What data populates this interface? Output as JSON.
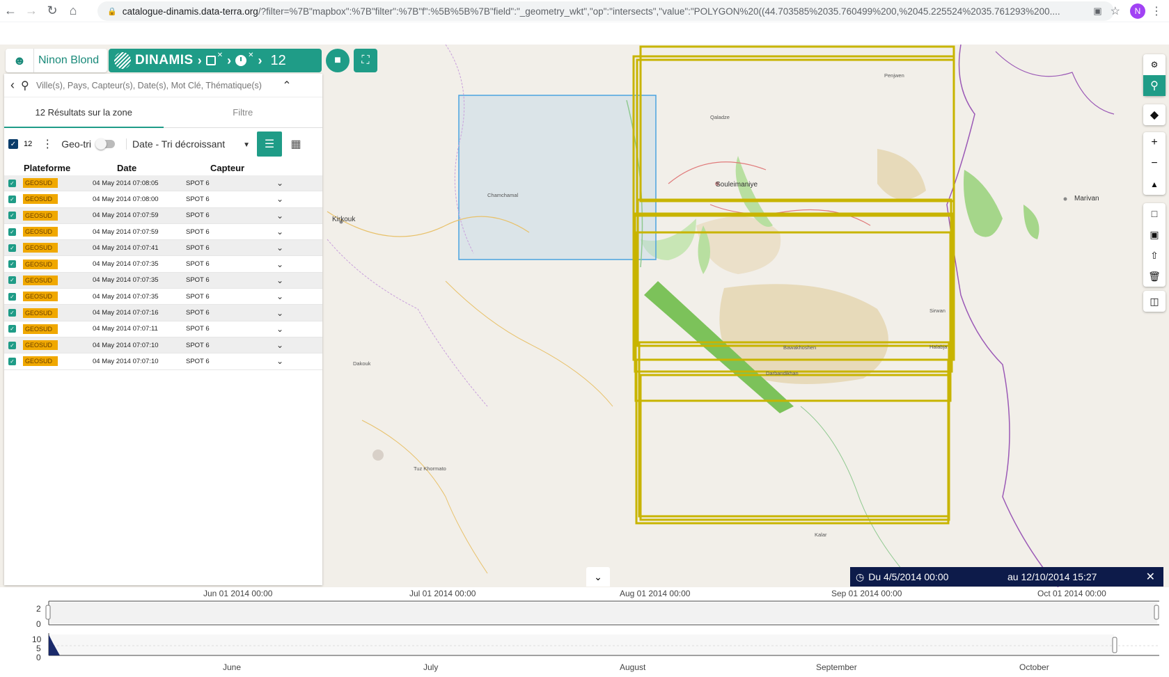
{
  "browser": {
    "url_host": "catalogue-dinamis.data-terra.org",
    "url_rest": "/?filter=%7B\"mapbox\":%7B\"filter\":%7B\"f\":%5B%5B%7B\"field\":\"_geometry_wkt\",\"op\":\"intersects\",\"value\":\"POLYGON%20((44.703585%2035.760499%200,%2045.225524%2035.761293%200....",
    "profile_initial": "N"
  },
  "header": {
    "user_name": "Ninon Blond",
    "brand": "DINAMIS",
    "result_count": "12"
  },
  "search": {
    "placeholder": "Ville(s), Pays, Capteur(s), Date(s), Mot Clé, Thématique(s)"
  },
  "tabs": [
    {
      "label": "12 Résultats sur la zone"
    },
    {
      "label": "Filtre"
    }
  ],
  "toolbar": {
    "selected_count": "12",
    "geotri_label": "Geo-tri",
    "sort_label": "Date - Tri décroissant"
  },
  "table": {
    "headers": [
      "Plateforme",
      "Date",
      "Capteur"
    ],
    "rows": [
      {
        "platform": "GEOSUD",
        "date": "04 May 2014 07:08:05",
        "sensor": "SPOT 6"
      },
      {
        "platform": "GEOSUD",
        "date": "04 May 2014 07:08:00",
        "sensor": "SPOT 6"
      },
      {
        "platform": "GEOSUD",
        "date": "04 May 2014 07:07:59",
        "sensor": "SPOT 6"
      },
      {
        "platform": "GEOSUD",
        "date": "04 May 2014 07:07:59",
        "sensor": "SPOT 6"
      },
      {
        "platform": "GEOSUD",
        "date": "04 May 2014 07:07:41",
        "sensor": "SPOT 6"
      },
      {
        "platform": "GEOSUD",
        "date": "04 May 2014 07:07:35",
        "sensor": "SPOT 6"
      },
      {
        "platform": "GEOSUD",
        "date": "04 May 2014 07:07:35",
        "sensor": "SPOT 6"
      },
      {
        "platform": "GEOSUD",
        "date": "04 May 2014 07:07:35",
        "sensor": "SPOT 6"
      },
      {
        "platform": "GEOSUD",
        "date": "04 May 2014 07:07:16",
        "sensor": "SPOT 6"
      },
      {
        "platform": "GEOSUD",
        "date": "04 May 2014 07:07:11",
        "sensor": "SPOT 6"
      },
      {
        "platform": "GEOSUD",
        "date": "04 May 2014 07:07:10",
        "sensor": "SPOT 6"
      },
      {
        "platform": "GEOSUD",
        "date": "04 May 2014 07:07:10",
        "sensor": "SPOT 6"
      }
    ]
  },
  "map": {
    "places": [
      {
        "name": "Kirkouk",
        "big": true
      },
      {
        "name": "Souleimaniye",
        "big": true
      },
      {
        "name": "Marivan",
        "big": true
      },
      {
        "name": "Tuz Khormato",
        "big": false
      },
      {
        "name": "Dakouk",
        "big": false
      },
      {
        "name": "Halabja",
        "big": false
      },
      {
        "name": "Chamchamal",
        "big": false
      },
      {
        "name": "Bawakhoshen",
        "big": false
      },
      {
        "name": "Darbandikhan",
        "big": false
      },
      {
        "name": "Sirwan",
        "big": false
      },
      {
        "name": "Qaladze",
        "big": false
      },
      {
        "name": "Penjwen",
        "big": false
      },
      {
        "name": "Kalar",
        "big": false
      }
    ],
    "footprint_color": "#c8b400",
    "aoi_color": "#4aa3df"
  },
  "date_range": {
    "from": "Du  4/5/2014 00:00",
    "to": "au  12/10/2014 15:27"
  },
  "timeline": {
    "top_ticks": [
      "Jun 01 2014 00:00",
      "Jul 01 2014 00:00",
      "Aug 01 2014 00:00",
      "Sep 01 2014 00:00",
      "Oct 01 2014 00:00"
    ],
    "top_axis": [
      "2",
      "0"
    ],
    "bottom_axis": [
      "10",
      "5",
      "0"
    ],
    "months": [
      "June",
      "July",
      "August",
      "September",
      "October"
    ]
  }
}
